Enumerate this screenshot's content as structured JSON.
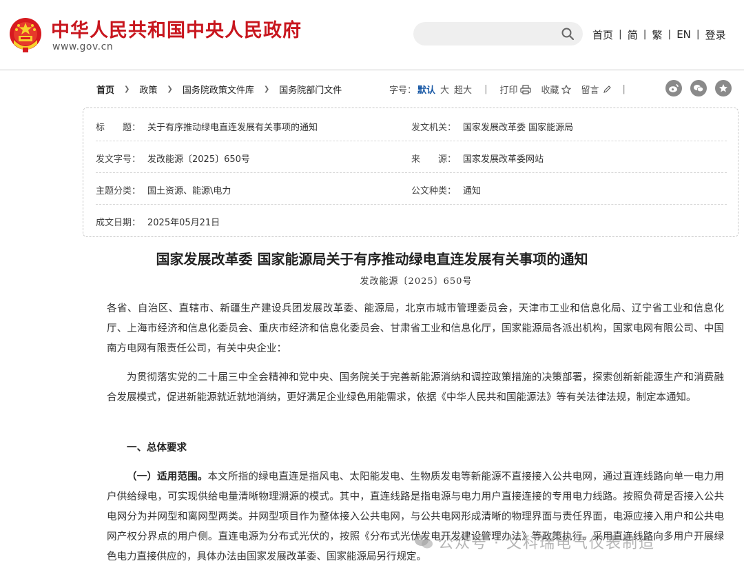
{
  "header": {
    "site_name": "中华人民共和国中央人民政府",
    "site_url": "www.gov.cn",
    "search_placeholder": "",
    "nav": [
      "首页",
      "简",
      "繁",
      "EN",
      "登录"
    ],
    "separator": "|"
  },
  "breadcrumb": {
    "items": [
      "首页",
      "政策",
      "国务院政策文件库",
      "国务院部门文件"
    ],
    "arrow": "❯"
  },
  "tools": {
    "font_label": "字号：",
    "font_default": "默认",
    "font_large": "大",
    "font_xlarge": "超大",
    "vbar": "|",
    "print": "打印",
    "favorite": "收藏",
    "comment": "留言"
  },
  "info": {
    "title_label": "标　　题：",
    "title_value": "关于有序推动绿电直连发展有关事项的通知",
    "issuer_label": "发文机关：",
    "issuer_value": "国家发展改革委  国家能源局",
    "docno_label": "发文字号：",
    "docno_value": "发改能源〔2025〕650号",
    "source_label": "来　　源：",
    "source_value": "国家发展改革委网站",
    "topic_label": "主题分类：",
    "topic_value": "国土资源、能源\\电力",
    "type_label": "公文种类：",
    "type_value": "通知",
    "date_label": "成文日期：",
    "date_value": "2025年05月21日"
  },
  "article": {
    "title": "国家发展改革委 国家能源局关于有序推动绿电直连发展有关事项的通知",
    "docno": "发改能源〔2025〕650号",
    "addressees": "各省、自治区、直辖市、新疆生产建设兵团发展改革委、能源局，北京市城市管理委员会，天津市工业和信息化局、辽宁省工业和信息化厅、上海市经济和信息化委员会、重庆市经济和信息化委员会、甘肃省工业和信息化厅，国家能源局各派出机构，国家电网有限公司、中国南方电网有限责任公司，有关中央企业：",
    "intro": "为贯彻落实党的二十届三中全会精神和党中央、国务院关于完善新能源消纳和调控政策措施的决策部署，探索创新新能源生产和消费融合发展模式，促进新能源就近就地消纳，更好满足企业绿色用能需求，依据《中华人民共和国能源法》等有关法律法规，制定本通知。",
    "section1": "一、总体要求",
    "sub1_title": "（一）适用范围。",
    "sub1_body": "本文所指的绿电直连是指风电、太阳能发电、生物质发电等新能源不直接接入公共电网，通过直连线路向单一电力用户供给绿电，可实现供给电量清晰物理溯源的模式。其中，直连线路是指电源与电力用户直接连接的专用电力线路。按照负荷是否接入公共电网分为并网型和离网型两类。并网型项目作为整体接入公共电网，与公共电网形成清晰的物理界面与责任界面，电源应接入用户和公共电网产权分界点的用户侧。直连电源为分布式光伏的，按照《分布式光伏发电开发建设管理办法》等政策执行。采用直连线路向多用户开展绿色电力直接供应的，具体办法由国家发展改革委、国家能源局另行规定。"
  },
  "watermark": {
    "text": "公众号 · 文科瑞电气仪表制造"
  },
  "colors": {
    "brand_red": "#c8161e",
    "font_active_blue": "#1b5aa6",
    "icon_gray": "#8a8a8a"
  }
}
